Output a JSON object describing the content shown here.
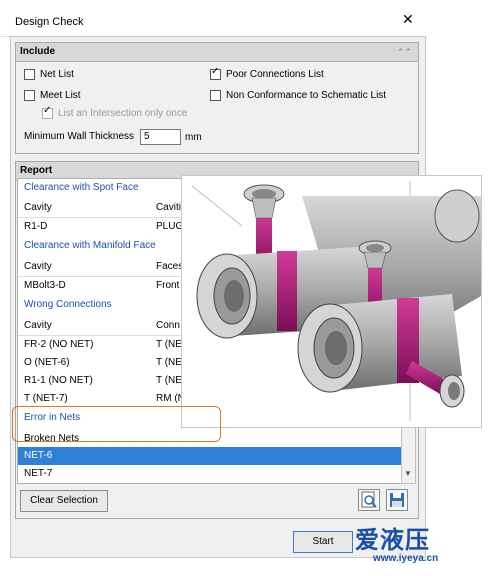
{
  "window": {
    "title": "Design Check",
    "close_glyph": "✕"
  },
  "include": {
    "header": "Include",
    "net_list": "Net List",
    "poor_connections": "Poor Connections List",
    "meet_list": "Meet List",
    "non_conformance": "Non Conformance to Schematic List",
    "intersection_only": "List an Intersection only once",
    "min_wall_label": "Minimum Wall Thickness",
    "min_wall_value": "5",
    "min_wall_unit": "mm",
    "poor_connections_checked": true,
    "net_list_checked": false,
    "meet_list_checked": false,
    "non_conformance_checked": false,
    "intersection_only_checked": true
  },
  "report": {
    "header": "Report",
    "rows": [
      {
        "type": "section",
        "c1": "Clearance with Spot Face"
      },
      {
        "type": "colhdr",
        "c1": "Cavity",
        "c2": "Cavitie"
      },
      {
        "type": "data",
        "c1": "R1-D",
        "c2": "PLUG-"
      },
      {
        "type": "section",
        "c1": "Clearance with Manifold Face"
      },
      {
        "type": "colhdr",
        "c1": "Cavity",
        "c2": "Faces"
      },
      {
        "type": "data",
        "c1": "MBolt3-D",
        "c2": "Front F"
      },
      {
        "type": "section",
        "c1": "Wrong Connections"
      },
      {
        "type": "colhdr",
        "c1": "Cavity",
        "c2": "Conn"
      },
      {
        "type": "data",
        "c1": "FR-2 (NO NET)",
        "c2": "T (NET"
      },
      {
        "type": "data",
        "c1": "O (NET-6)",
        "c2": "T (NET"
      },
      {
        "type": "data",
        "c1": "R1-1 (NO NET)",
        "c2": "T (NET"
      },
      {
        "type": "data",
        "c1": "T (NET-7)",
        "c2": "RM (N"
      },
      {
        "type": "section",
        "c1": "Error in Nets"
      },
      {
        "type": "colhdr",
        "c1": "Broken Nets",
        "c2": ""
      },
      {
        "type": "selected",
        "c1": "NET-6",
        "c2": ""
      },
      {
        "type": "data",
        "c1": "NET-7",
        "c2": ""
      }
    ],
    "clear_selection": "Clear Selection",
    "zoom_icon": "magnifier-icon",
    "save_icon": "save-icon"
  },
  "footer": {
    "start": "Start"
  },
  "watermark": {
    "brand": "爱液压",
    "url": "www.iyeya.cn"
  },
  "colors": {
    "selected": "#2f7fd6",
    "section_text": "#1f4fb0",
    "manifold_gray": "#a9a9a9",
    "port_magenta": "#b0147a",
    "highlight_border": "#e07820"
  }
}
